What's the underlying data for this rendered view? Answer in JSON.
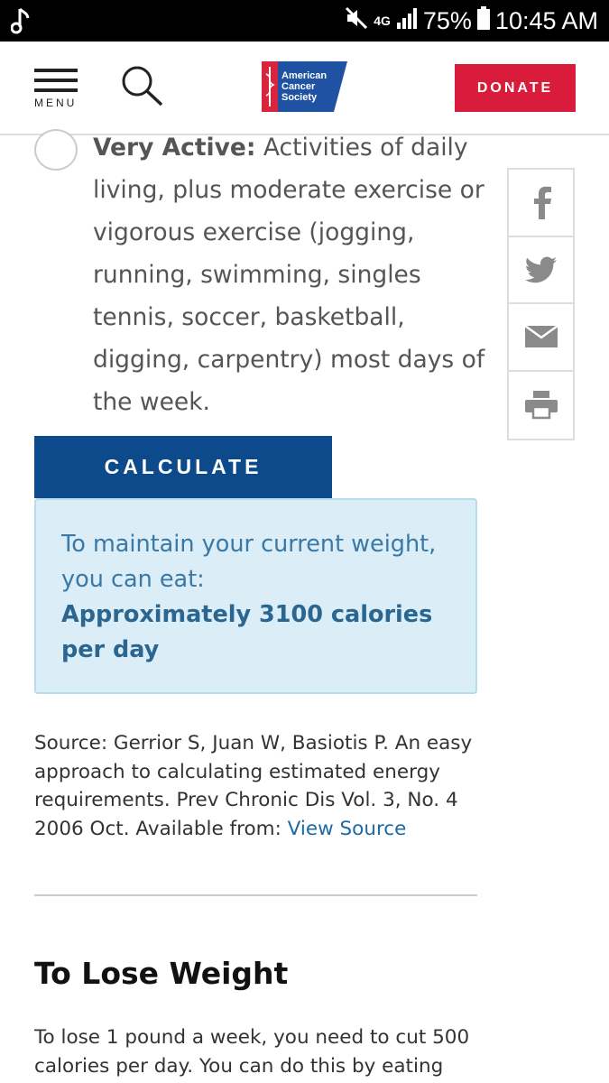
{
  "status_bar": {
    "battery": "75%",
    "time": "10:45 AM",
    "network": "4G",
    "icons": [
      "music-note-icon",
      "mute-icon",
      "signal-icon",
      "battery-icon"
    ]
  },
  "header": {
    "menu_label": "MENU",
    "logo_lines": [
      "American",
      "Cancer",
      "Society"
    ],
    "donate_label": "DONATE",
    "colors": {
      "donate": "#d91c3c",
      "logo": "#1f52a3",
      "logo_red": "#d6253c"
    }
  },
  "option": {
    "label": "Very Active:",
    "description": " Activities of daily living, plus moderate exercise or vigorous exercise (jogging, running, swimming, singles tennis, soccer, basketball, digging, carpentry) most days of the week."
  },
  "share": {
    "items": [
      "facebook-icon",
      "twitter-icon",
      "email-icon",
      "print-icon"
    ]
  },
  "calculate_label": "CALCULATE",
  "result": {
    "line1": "To maintain your current weight, you can eat:",
    "value": "Approximately 3100 calories per day",
    "colors": {
      "background": "#dbedf6",
      "text": "#3a78a6"
    }
  },
  "source": {
    "text": "Source: Gerrior S, Juan W, Basiotis P. An easy approach to calculating estimated energy requirements. Prev Chronic Dis Vol. 3, No. 4 2006 Oct. Available from: ",
    "link": "View Source"
  },
  "lose_weight": {
    "title": "To Lose Weight",
    "body": "To lose 1 pound a week, you need to cut 500 calories per day. You can do this by eating"
  }
}
